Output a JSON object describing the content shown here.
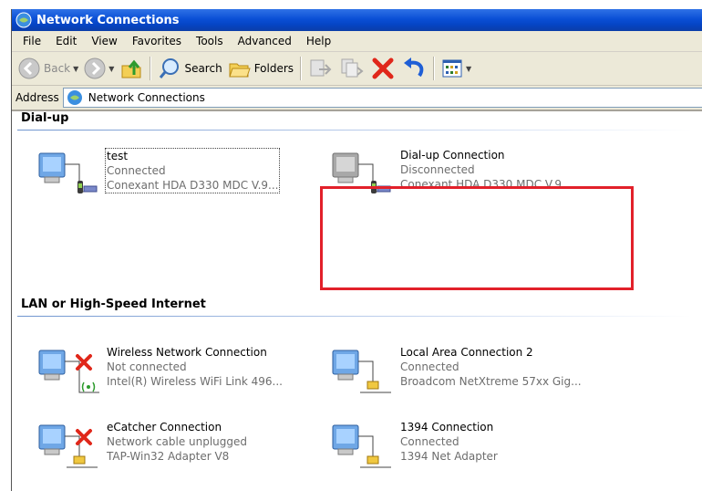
{
  "window": {
    "title": "Network Connections"
  },
  "menu": [
    "File",
    "Edit",
    "View",
    "Favorites",
    "Tools",
    "Advanced",
    "Help"
  ],
  "toolbar": {
    "back": "Back",
    "search": "Search",
    "folders": "Folders"
  },
  "address": {
    "label": "Address",
    "value": "Network Connections"
  },
  "groups": [
    {
      "title": "Dial-up",
      "items": [
        {
          "name": "test",
          "status": "Connected",
          "device": "Conexant HDA D330 MDC V.9...",
          "icon": "dialup-icon"
        },
        {
          "name": "Dial-up Connection",
          "status": "Disconnected",
          "device": "Conexant HDA D330 MDC V.9...",
          "icon": "dialup-disconnected-icon"
        }
      ]
    },
    {
      "title": "LAN or High-Speed Internet",
      "items": [
        {
          "name": "Wireless Network Connection",
          "status": "Not connected",
          "device": "Intel(R) Wireless WiFi Link 496...",
          "icon": "wireless-disconnected-icon"
        },
        {
          "name": "Local Area Connection 2",
          "status": "Connected",
          "device": "Broadcom NetXtreme 57xx Gig...",
          "icon": "lan-icon"
        },
        {
          "name": "eCatcher Connection",
          "status": "Network cable unplugged",
          "device": "TAP-Win32 Adapter V8",
          "icon": "lan-unplugged-icon"
        },
        {
          "name": "1394 Connection",
          "status": "Connected",
          "device": "1394 Net Adapter",
          "icon": "lan-icon"
        }
      ]
    }
  ],
  "colors": {
    "title_bar": "#0a4fd6",
    "highlight_border": "#e2202a",
    "status_text": "#6d6d6d"
  }
}
